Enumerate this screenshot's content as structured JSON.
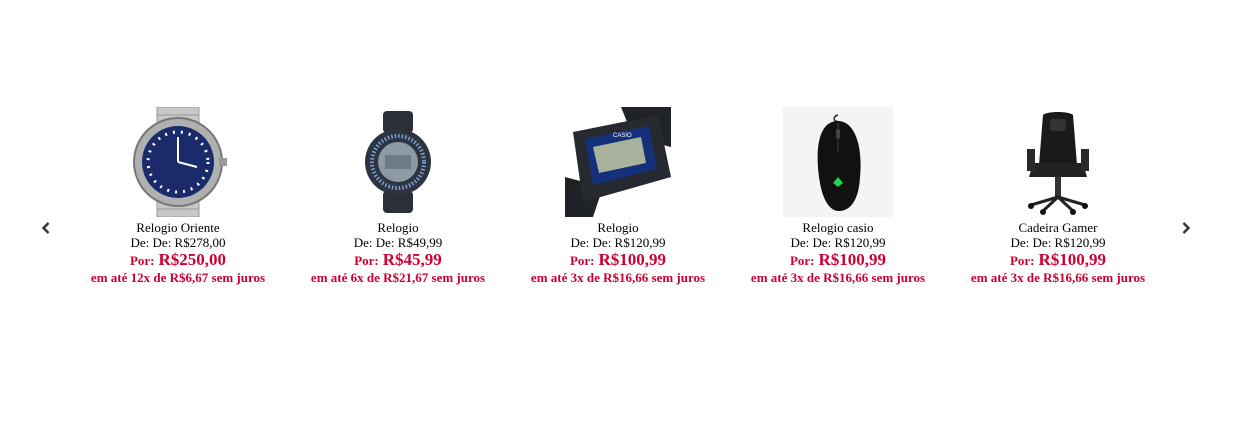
{
  "nav": {
    "prev_icon": "chevron-left-icon",
    "next_icon": "chevron-right-icon"
  },
  "colors": {
    "price": "#cc0033"
  },
  "products": [
    {
      "name": "Relogio Oriente",
      "from": "De: De: R$278,00",
      "by_label": "Por:",
      "price": "R$250,00",
      "installments": "em até 12x de R$6,67 sem juros",
      "image": "analog-watch-image"
    },
    {
      "name": "Relogio",
      "from": "De: De: R$49,99",
      "by_label": "Por:",
      "price": "R$45,99",
      "installments": "em até 6x de R$21,67 sem juros",
      "image": "digital-round-watch-image"
    },
    {
      "name": "Relogio",
      "from": "De: De: R$120,99",
      "by_label": "Por:",
      "price": "R$100,99",
      "installments": "em até 3x de R$16,66 sem juros",
      "image": "casio-watch-image"
    },
    {
      "name": "Relogio casio",
      "from": "De: De: R$120,99",
      "by_label": "Por:",
      "price": "R$100,99",
      "installments": "em até 3x de R$16,66 sem juros",
      "image": "gaming-mouse-image"
    },
    {
      "name": "Cadeira Gamer",
      "from": "De: De: R$120,99",
      "by_label": "Por:",
      "price": "R$100,99",
      "installments": "em até 3x de R$16,66 sem juros",
      "image": "gamer-chair-image"
    }
  ]
}
